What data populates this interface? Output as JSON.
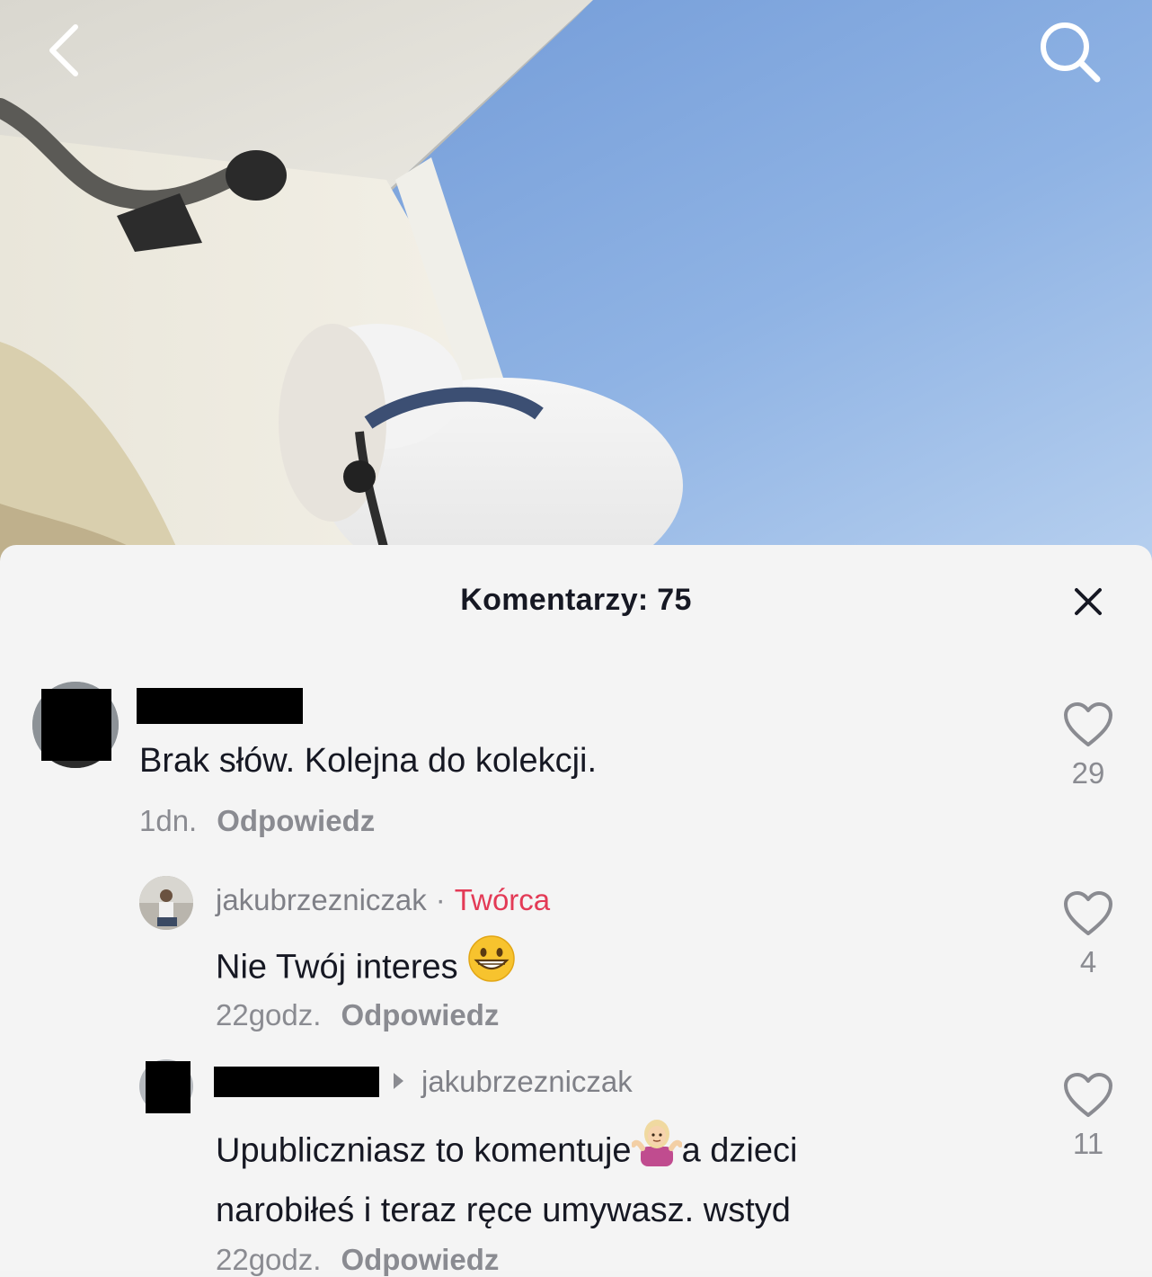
{
  "header": {
    "back_icon": "chevron-left-icon",
    "search_icon": "search-icon"
  },
  "sheet": {
    "title": "Komentarzy: 75",
    "close_icon": "close-icon"
  },
  "comments": [
    {
      "username": "",
      "username_redacted": true,
      "avatar_redacted": true,
      "text": "Brak słów. Kolejna do kolekcji.",
      "time": "1dn.",
      "reply_label": "Odpowiedz",
      "likes": "29"
    },
    {
      "username": "jakubrzezniczak",
      "separator": "·",
      "badge": "Twórca",
      "text": "Nie Twój interes",
      "emoji": "grinning-face-emoji",
      "time": "22godz.",
      "reply_label": "Odpowiedz",
      "likes": "4"
    },
    {
      "username": "",
      "username_redacted": true,
      "avatar_redacted": true,
      "reply_to": "jakubrzezniczak",
      "text_line1_a": "Upubliczniasz to komentuje",
      "emoji": "person-shrugging-emoji",
      "text_line1_b": "a dzieci",
      "text_line2": "narobiłeś i teraz ręce umywasz. wstyd",
      "time": "22godz.",
      "reply_label": "Odpowiedz",
      "likes": "11"
    }
  ],
  "colors": {
    "creator_badge": "#e33a56",
    "secondary_text": "#8a8b91",
    "primary_text": "#161823",
    "sheet_background": "#f4f4f4"
  }
}
